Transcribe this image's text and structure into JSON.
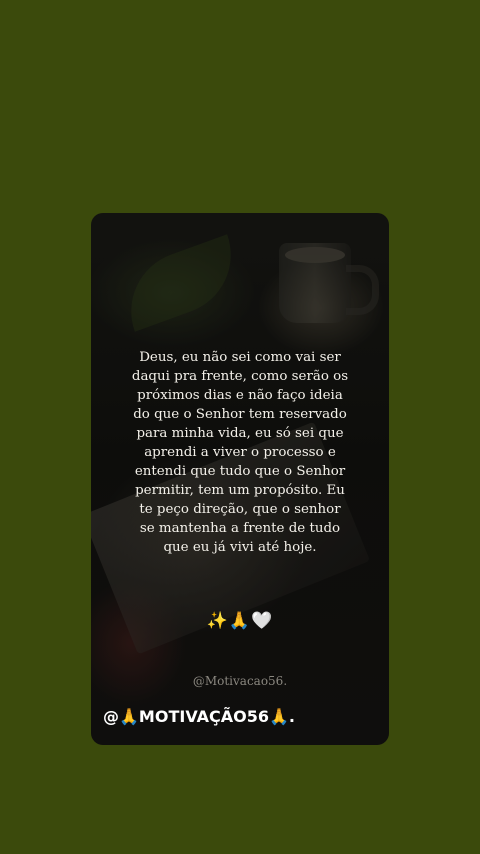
{
  "background_color": "#3b4a0c",
  "card": {
    "message": "Deus, eu não sei como vai ser daqui pra frente, como serão os próximos dias e não faço ideia do que o Senhor tem reservado para minha vida, eu só sei que aprendi a viver o processo e entendi que tudo que o Senhor permitir, tem um propósito. Eu te peço direção, que o senhor se mantenha a frente de tudo que eu já vivi até hoje.",
    "emojis": "✨🙏🤍",
    "watermark": "@Motivacao56.",
    "handle": "@🙏MOTIVAÇÃO56🙏."
  }
}
